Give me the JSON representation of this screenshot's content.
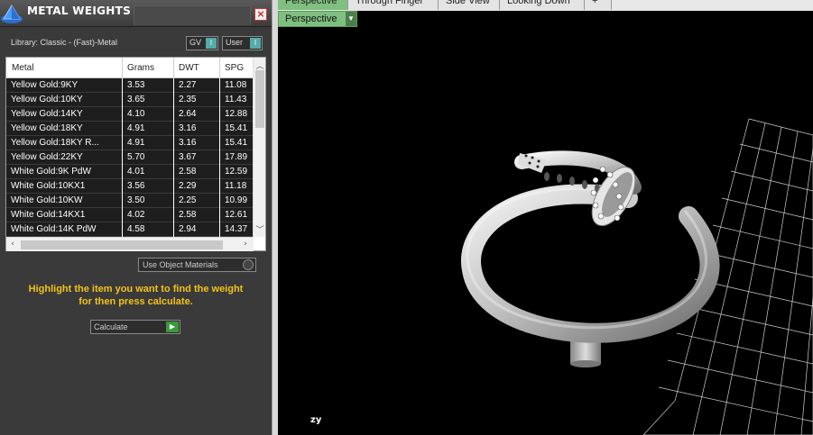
{
  "panel": {
    "title": "METAL WEIGHTS",
    "close_label": "×",
    "library": "Library: Classic - (Fast)-Metal",
    "gv_label": "GV",
    "user_label": "User",
    "use_object_materials": "Use Object Materials",
    "instruction_line1": "Highlight the item you want to find the weight",
    "instruction_line2": "for then press calculate.",
    "calculate_label": "Calculate"
  },
  "table": {
    "columns": [
      "Metal",
      "Grams",
      "DWT",
      "SPG"
    ],
    "rows": [
      [
        "Yellow Gold:9KY",
        "3.53",
        "2.27",
        "11.08"
      ],
      [
        "Yellow Gold:10KY",
        "3.65",
        "2.35",
        "11.43"
      ],
      [
        "Yellow Gold:14KY",
        "4.10",
        "2.64",
        "12.88"
      ],
      [
        "Yellow Gold:18KY",
        "4.91",
        "3.16",
        "15.41"
      ],
      [
        "Yellow Gold:18KY R...",
        "4.91",
        "3.16",
        "15.41"
      ],
      [
        "Yellow Gold:22KY",
        "5.70",
        "3.67",
        "17.89"
      ],
      [
        "White Gold:9K PdW",
        "4.01",
        "2.58",
        "12.59"
      ],
      [
        "White Gold:10KX1",
        "3.56",
        "2.29",
        "11.18"
      ],
      [
        "White Gold:10KW",
        "3.50",
        "2.25",
        "10.99"
      ],
      [
        "White Gold:14KX1",
        "4.02",
        "2.58",
        "12.61"
      ],
      [
        "White Gold:14K PdW",
        "4.58",
        "2.94",
        "14.37"
      ]
    ]
  },
  "viewport": {
    "tabs": [
      "Perspective",
      "Through Finger",
      "Side View",
      "Looking Down",
      "+"
    ],
    "active_view": "Perspective",
    "axis_label": "zy"
  },
  "colors": {
    "instruction": "#f2c21a",
    "active_tab": "#7fbf7f"
  }
}
